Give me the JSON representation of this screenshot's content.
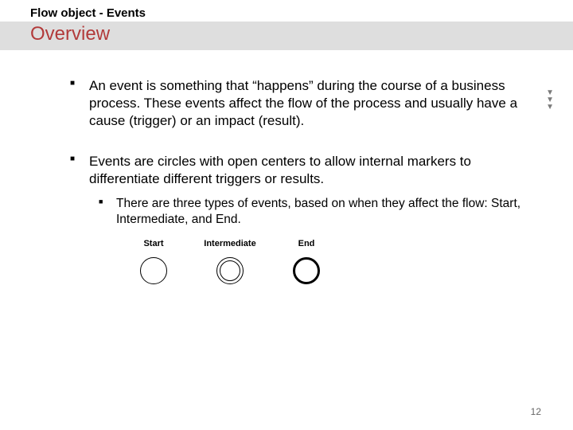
{
  "header": {
    "supertitle": "Flow object - Events",
    "title": "Overview"
  },
  "bullets": {
    "b1": "An event is something that “happens” during the course of a business process. These events affect the flow of the process and usually have a cause (trigger) or an impact (result).",
    "b2": "Events are circles with open centers to allow internal markers to differentiate different triggers or results.",
    "b2_sub1": "There are three types of events, based on when they affect the flow: Start, Intermediate, and End."
  },
  "diagram": {
    "labels": {
      "start": "Start",
      "intermediate": "Intermediate",
      "end": "End"
    }
  },
  "pagenum": "12"
}
